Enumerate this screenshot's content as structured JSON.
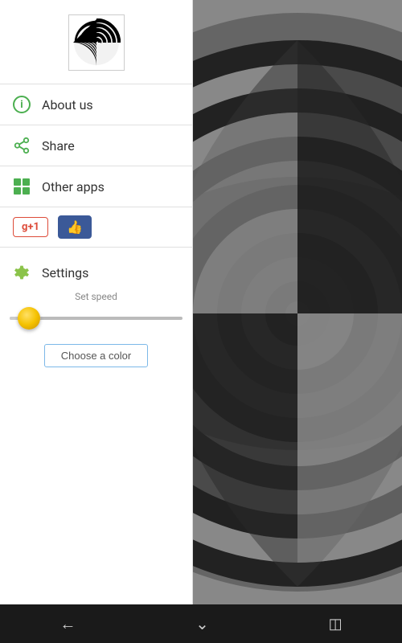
{
  "sidebar": {
    "menu_items": [
      {
        "id": "about-us",
        "label": "About us",
        "icon": "info"
      },
      {
        "id": "share",
        "label": "Share",
        "icon": "share"
      },
      {
        "id": "other-apps",
        "label": "Other apps",
        "icon": "apps"
      }
    ],
    "settings": {
      "label": "Settings",
      "speed_title": "Set speed",
      "slider_value": 18,
      "choose_color_label": "Choose a color"
    },
    "social": {
      "gplus_label": "+1",
      "like_label": "👍"
    }
  },
  "navbar": {
    "back_label": "←",
    "home_label": "⬡",
    "recents_label": "▣"
  }
}
